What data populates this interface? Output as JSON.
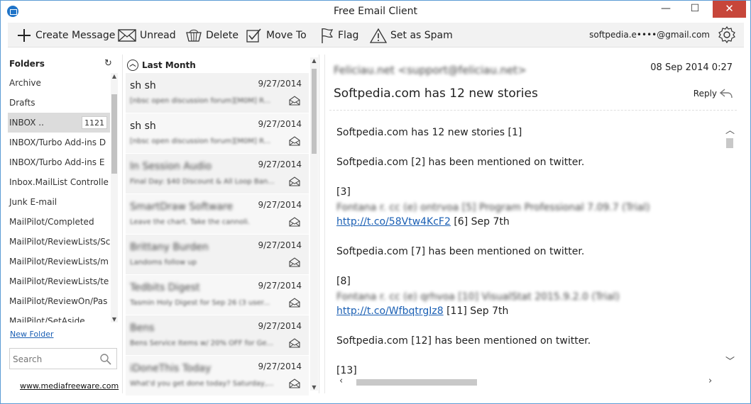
{
  "window": {
    "title": "Free Email Client",
    "min": "—",
    "max": "☐",
    "close": "✕"
  },
  "toolbar": {
    "create": "Create Message",
    "unread": "Unread",
    "delete": "Delete",
    "move": "Move To",
    "flag": "Flag",
    "spam": "Set as Spam",
    "account": "softpedia.e••••@gmail.com"
  },
  "folders": {
    "header": "Folders",
    "items": [
      {
        "label": "Archive"
      },
      {
        "label": "Drafts"
      },
      {
        "label": "INBOX ..",
        "count": "1121"
      },
      {
        "label": "INBOX/Turbo Add-ins D"
      },
      {
        "label": "INBOX/Turbo Add-ins E"
      },
      {
        "label": "Inbox.MailList Controlle"
      },
      {
        "label": "Junk E-mail"
      },
      {
        "label": "MailPilot/Completed"
      },
      {
        "label": "MailPilot/ReviewLists/Sc"
      },
      {
        "label": "MailPilot/ReviewLists/m"
      },
      {
        "label": "MailPilot/ReviewLists/te"
      },
      {
        "label": "MailPilot/ReviewOn/Pas"
      },
      {
        "label": "MailPilot/SetAside"
      }
    ],
    "new_folder": "New Folder",
    "search_placeholder": "Search",
    "site": "www.mediafreeware.com"
  },
  "messages": {
    "group": "Last Month",
    "items": [
      {
        "sender": "sh sh",
        "date": "9/27/2014",
        "preview": "[nbsc open discussion forum][M0M] R...",
        "blur": false
      },
      {
        "sender": "sh sh",
        "date": "9/27/2014",
        "preview": "[nbsc open discussion forum][M0M] R...",
        "blur": false
      },
      {
        "sender": "In Session Audio",
        "date": "9/27/2014",
        "preview": "Final Day: $40 Discount & All Loop Ban...",
        "blur": true
      },
      {
        "sender": "SmartDraw Software",
        "date": "9/27/2014",
        "preview": "Leave the chart. Take the cannoli.",
        "blur": true
      },
      {
        "sender": "Brittany Burden",
        "date": "9/27/2014",
        "preview": "Landoms follow up",
        "blur": true
      },
      {
        "sender": "Tedbits Digest",
        "date": "9/27/2014",
        "preview": "Tasmin Holy Digest for Sep 26 (3 user...",
        "blur": true
      },
      {
        "sender": "Bens",
        "date": "9/27/2014",
        "preview": "Bens Service Items w/ 20% OFF for Ge...",
        "blur": true
      },
      {
        "sender": "iDoneThis Today",
        "date": "9/27/2014",
        "preview": "What'd you get done today? Saturday,...",
        "blur": true
      }
    ]
  },
  "reader": {
    "from": "Feliciau.net <support@feliciau.net>",
    "date": "08 Sep 2014 0:27",
    "subject": "Softpedia.com has 12 new stories",
    "reply": "Reply",
    "body": {
      "p1": "Softpedia.com has 12 new stories [1]",
      "p2": "Softpedia.com [2] has been mentioned on twitter.",
      "p3": "[3]",
      "p3b": "Fontana r. cc (e) ontrvoa [5] Program Professional 7.09.7 (Trial)",
      "link1": "http://t.co/58Vtw4KcF2",
      "link1_tail": " [6] Sep 7th",
      "p4": "Softpedia.com [7] has been mentioned on twitter.",
      "p5": "[8]",
      "p5b": "Fontana r. cc (e) qrhvoa [10] VisualStat 2015.9.2.0 (Trial)",
      "link2": "http://t.co/WfbqtrgIz8",
      "link2_tail": " [11] Sep 7th",
      "p6": "Softpedia.com [12] has been mentioned on twitter.",
      "p7": "[13]"
    }
  }
}
